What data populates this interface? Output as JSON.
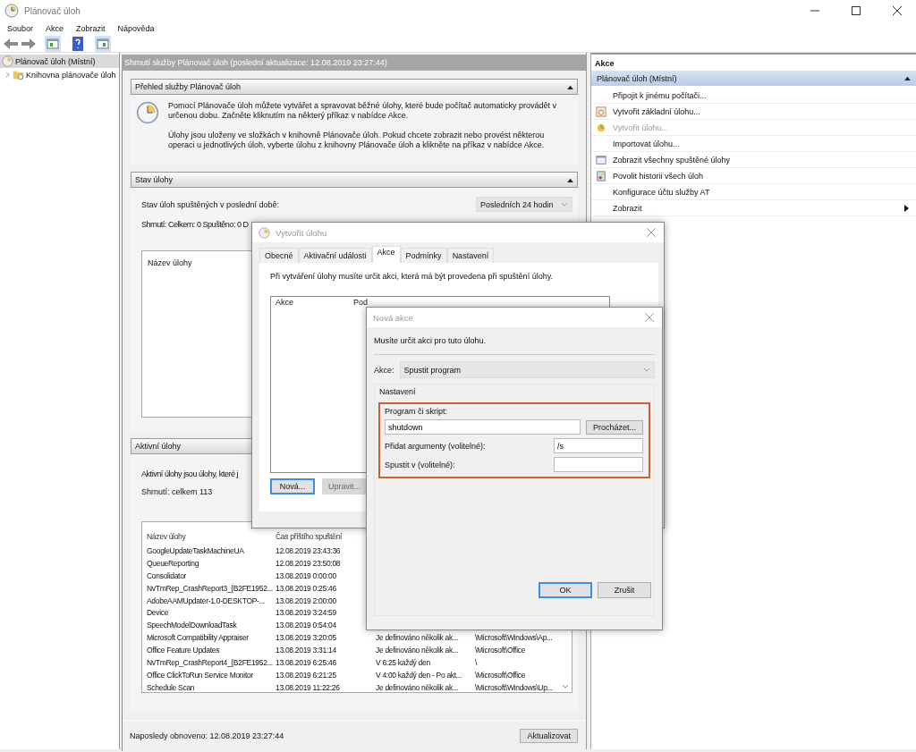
{
  "window": {
    "title": "Plánovač úloh"
  },
  "menu": [
    "Soubor",
    "Akce",
    "Zobrazit",
    "Nápověda"
  ],
  "tree": [
    {
      "label": "Plánovač úloh (Místní)",
      "selected": true,
      "children": [
        {
          "label": "Knihovna plánovače úloh",
          "selected": false,
          "expanded": false
        }
      ]
    }
  ],
  "center": {
    "header": "Shrnutí služby Plánovač úloh (poslední aktualizace: 12.08.2019 23:27:44)",
    "overview": {
      "title": "Přehled služby Plánovač úloh",
      "expanded": true,
      "paragraphs": [
        "Pomocí Plánovače úloh můžete vytvářet a spravovat běžné úlohy, které bude počítač automaticky provádět v určenou dobu. Začněte kliknutím na některý příkaz v nabídce Akce.",
        "Úlohy jsou uloženy ve složkách v knihovně Plánovače úloh. Pokud chcete zobrazit nebo provést některou operaci u jednotlivých úloh, vyberte úlohu z knihovny Plánovače úloh a klikněte na příkaz v nabídce Akce."
      ]
    },
    "status": {
      "title": "Stav úlohy",
      "expanded": true,
      "label": "Stav úloh spuštěných v poslední době:",
      "period": "Posledních 24 hodin",
      "summary": "Shrnutí: Celkem: 0 Spuštěno: 0 D",
      "list_header": "Název úlohy"
    },
    "active": {
      "title": "Aktivní úlohy",
      "text": "Aktivní úlohy jsou úlohy, které j",
      "summary": "Shrnutí: celkem 113",
      "columns": [
        "Název úlohy",
        "Čas příštího spuštění"
      ],
      "rows": [
        {
          "cells": [
            "GoogleUpdateTaskMachineUA",
            "12.08.2019 23:43:36"
          ]
        },
        {
          "cells": [
            "QueueReporting",
            "12.08.2019 23:50:08"
          ]
        },
        {
          "cells": [
            "Consolidator",
            "13.08.2019 0:00:00"
          ]
        },
        {
          "cells": [
            "NvTmRep_CrashReport3_{B2FE1952...",
            "13.08.2019 0:25:46"
          ]
        },
        {
          "cells": [
            "AdobeAAMUpdater-1.0-DESKTOP-...",
            "13.08.2019 2:00:00"
          ]
        },
        {
          "cells": [
            "Device",
            "13.08.2019 3:24:59"
          ]
        },
        {
          "cells": [
            "SpeechModelDownloadTask",
            "13.08.2019 0:54:04"
          ]
        },
        {
          "cells": [
            "Microsoft Compatibility Appraiser",
            "13.08.2019 3:20:05",
            "Je definováno několik ak...",
            "\\Microsoft\\Windows\\Ap..."
          ]
        },
        {
          "cells": [
            "Office Feature Updates",
            "13.08.2019 3:31:14",
            "Je definováno několik ak...",
            "\\Microsoft\\Office"
          ]
        },
        {
          "cells": [
            "NvTmRep_CrashReport4_{B2FE1952...",
            "13.08.2019 6:25:46",
            "V 6:25 každý den",
            "\\"
          ]
        },
        {
          "cells": [
            "Office ClickToRun Service Monitor",
            "13.08.2019 6:21:25",
            "V 4:00 každý den - Po akt...",
            "\\Microsoft\\Office"
          ]
        },
        {
          "cells": [
            "Schedule Scan",
            "13.08.2019 11:22:26",
            "Je definováno několik ak...",
            "\\Microsoft\\Windows\\Up..."
          ]
        }
      ]
    },
    "refreshed": "Naposledy obnoveno: 12.08.2019 23:27:44",
    "refresh_button": "Aktualizovat"
  },
  "actions": {
    "title": "Akce",
    "group": {
      "title": "Plánovač úloh (Místní)",
      "expanded": true
    },
    "items": [
      {
        "kind": "plain",
        "label": "Připojit k jinému počítači...",
        "disabled": false
      },
      {
        "kind": "wizard",
        "label": "Vytvořit základní úlohu...",
        "disabled": false
      },
      {
        "kind": "task",
        "label": "Vytvořit úlohu...",
        "disabled": true
      },
      {
        "kind": "plain",
        "label": "Importovat úlohu...",
        "disabled": false
      },
      {
        "kind": "running",
        "label": "Zobrazit všechny spuštěné úlohy",
        "disabled": false
      },
      {
        "kind": "history",
        "label": "Povolit historii všech úloh",
        "disabled": false
      },
      {
        "kind": "plain",
        "label": "Konfigurace účtu služby AT",
        "disabled": false
      },
      {
        "kind": "submenu",
        "label": "Zobrazit",
        "disabled": false
      }
    ]
  },
  "create_dialog": {
    "title": "Vytvořit úlohu",
    "tabs": [
      {
        "label": "Obecné",
        "selected": false
      },
      {
        "label": "Aktivační události",
        "selected": false
      },
      {
        "label": "Akce",
        "selected": true
      },
      {
        "label": "Podmínky",
        "selected": false
      },
      {
        "label": "Nastavení",
        "selected": false
      }
    ],
    "instruction": "Při vytváření úlohy musíte určit akci, která má být provedena při spuštění úlohy.",
    "columns": [
      "Akce",
      "Pod"
    ],
    "buttons": [
      {
        "label": "Nová...",
        "default": true,
        "disabled": false
      },
      {
        "label": "Upravit...",
        "default": false,
        "disabled": true
      }
    ]
  },
  "action_dialog": {
    "title": "Nová akce",
    "message": "Musíte určit akci pro tuto úlohu.",
    "action_label": "Akce:",
    "action_value": "Spustit program",
    "group": "Nastavení",
    "program_label": "Program či skript:",
    "program_value": "shutdown",
    "browse": "Procházet...",
    "args_label": "Přidat argumenty (volitelné):",
    "args_value": "/s",
    "start_label": "Spustit v (volitelné):",
    "buttons": [
      {
        "label": "OK",
        "default": true,
        "disabled": false
      },
      {
        "label": "Zrušit",
        "default": false,
        "disabled": false
      }
    ]
  }
}
